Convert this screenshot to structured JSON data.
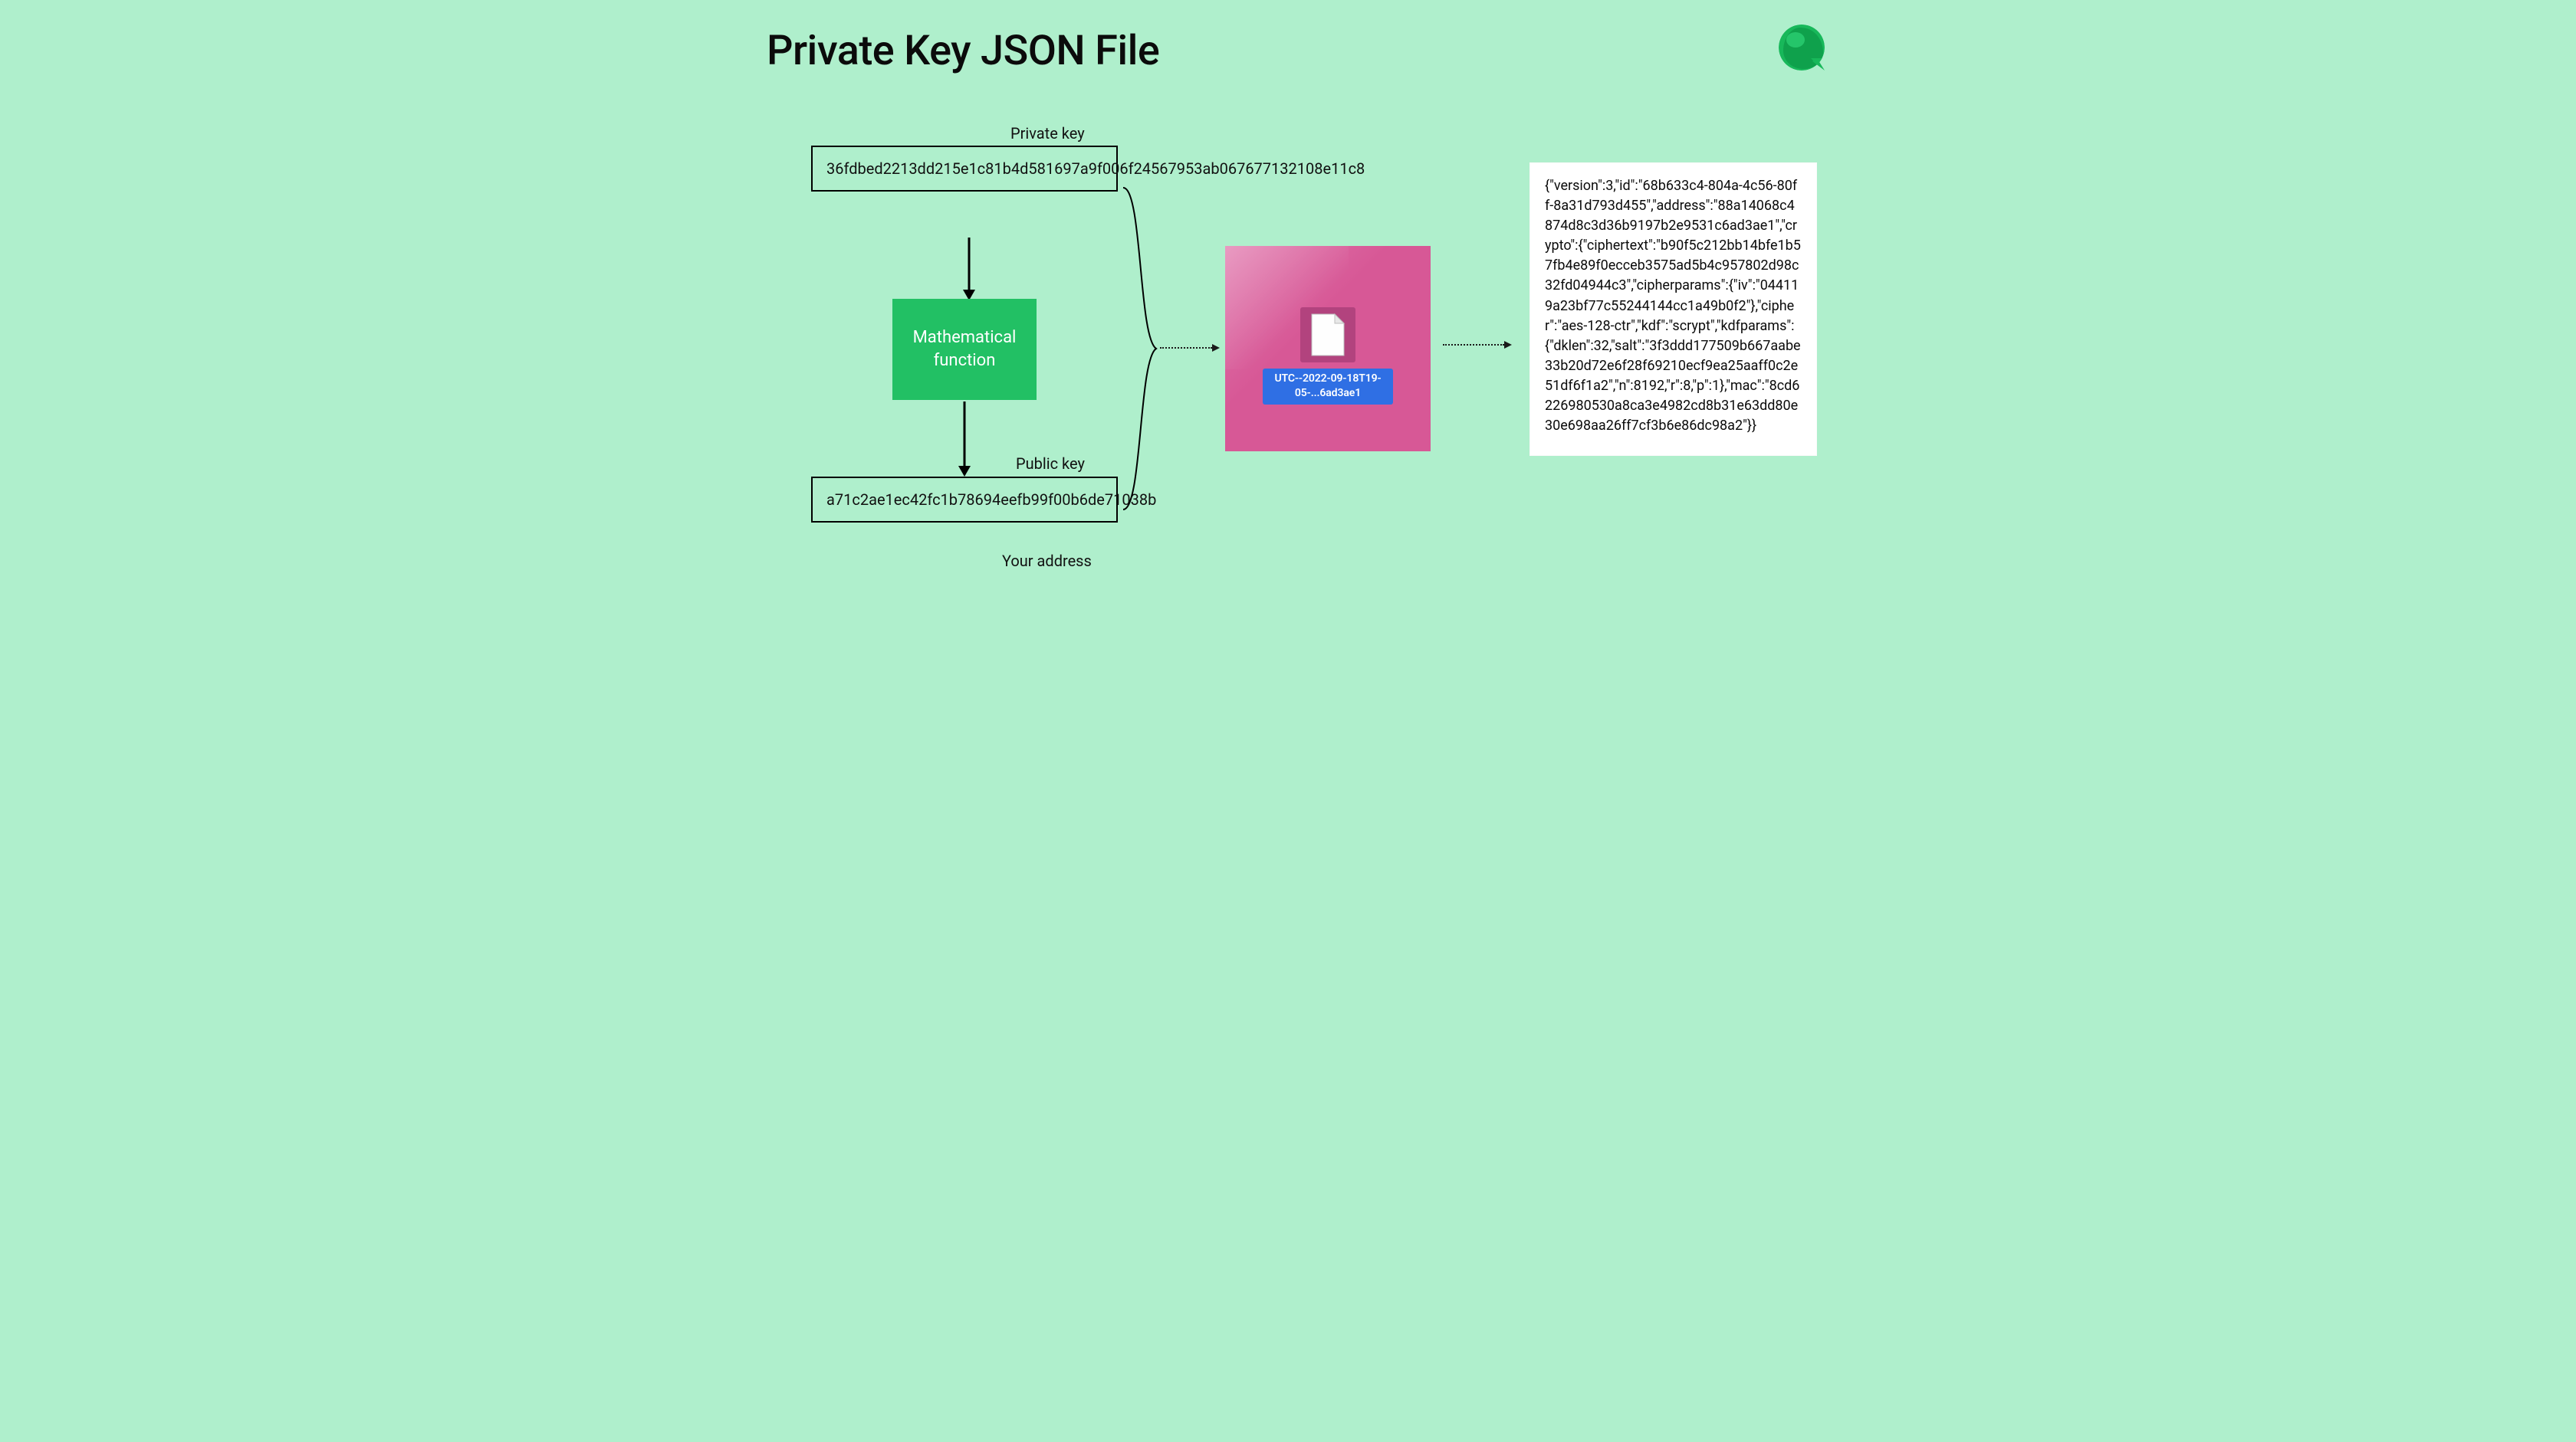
{
  "title": "Private Key JSON File",
  "labels": {
    "private_key": "Private key",
    "public_key": "Public key",
    "your_address": "Your address"
  },
  "private_key": "36fdbed2213dd215e1c81b4d581697a9f006f24567953ab067677132108e11c8",
  "math_box": "Mathematical function",
  "public_key": "a71c2ae1ec42fc1b78694eefb99f00b6de71038b",
  "file": {
    "name": "UTC--2022-09-18T19-05-...6ad3ae1"
  },
  "json_content": "{\"version\":3,\"id\":\"68b633c4-804a-4c56-80ff-8a31d793d455\",\"address\":\"88a14068c4874d8c3d36b9197b2e9531c6ad3ae1\",\"crypto\":{\"ciphertext\":\"b90f5c212bb14bfe1b57fb4e89f0ecceb3575ad5b4c957802d98c32fd04944c3\",\"cipherparams\":{\"iv\":\"044119a23bf77c55244144cc1a49b0f2\"},\"cipher\":\"aes-128-ctr\",\"kdf\":\"scrypt\",\"kdfparams\":{\"dklen\":32,\"salt\":\"3f3ddd177509b667aabe33b20d72e6f28f69210ecf9ea25aaff0c2e51df6f1a2\",\"n\":8192,\"r\":8,\"p\":1},\"mac\":\"8cd6226980530a8ca3e4982cd8b31e63dd80e30e698aa26ff7cf3b6e86dc98a2\"}}"
}
